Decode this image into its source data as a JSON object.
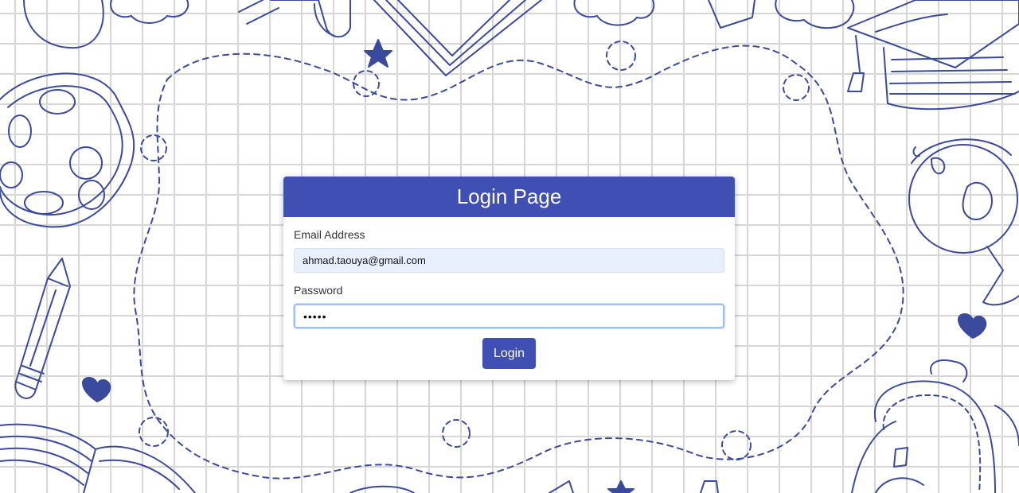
{
  "colors": {
    "accent": "#3f4fb3",
    "doodle_stroke": "#3a4a9c",
    "grid": "#d6d6d6",
    "email_field_bg": "#e8f0fe"
  },
  "login_form": {
    "title": "Login Page",
    "email_label": "Email Address",
    "email_value": "ahmad.taouya@gmail.com",
    "password_label": "Password",
    "password_value": "•••••",
    "submit_label": "Login"
  },
  "decorations": {
    "icons": [
      "palette-icon",
      "pencil-icon",
      "book-icon",
      "star-icon",
      "heart-icon",
      "graduation-cap-icon",
      "globe-icon",
      "backpack-icon",
      "diploma-scroll-icon",
      "cloud-icon"
    ]
  }
}
